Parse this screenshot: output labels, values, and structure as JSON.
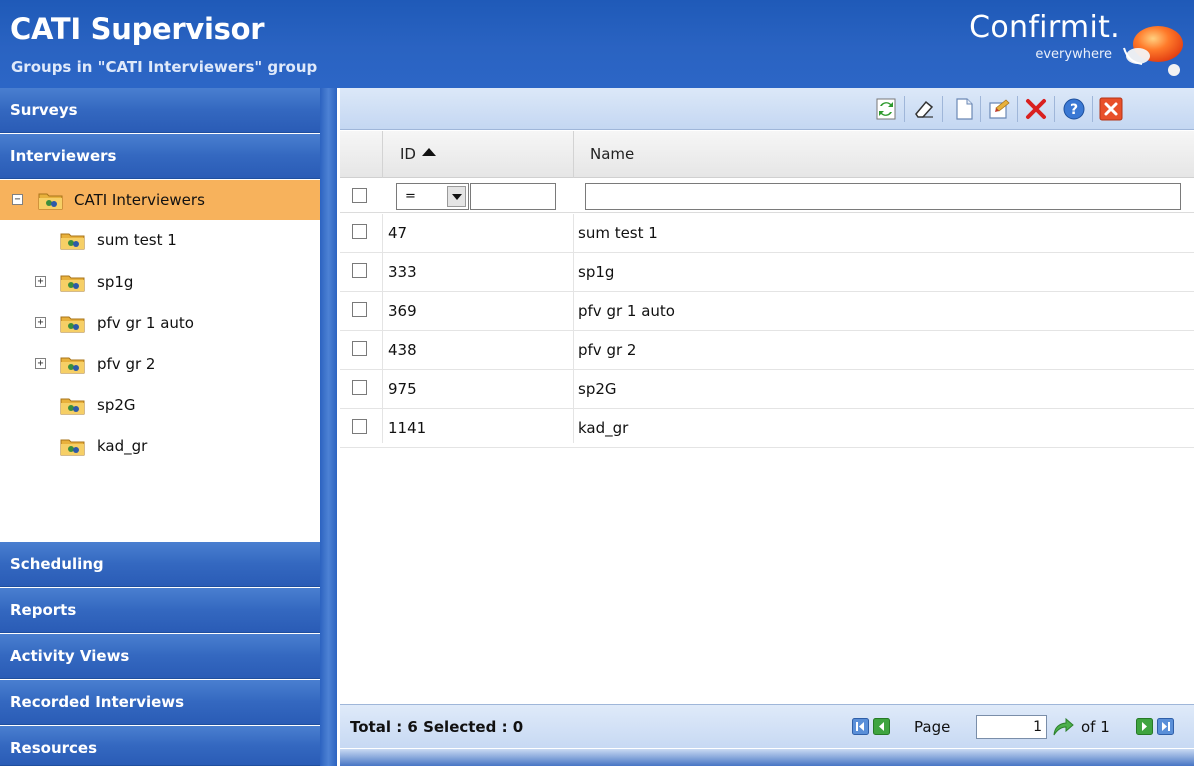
{
  "header": {
    "title": "CATI Supervisor",
    "subtitle": "Groups in \"CATI Interviewers\" group",
    "brand_name": "Confirmit.",
    "brand_tagline": "everywhere"
  },
  "sidebar": {
    "sections_top": [
      {
        "label": "Surveys"
      },
      {
        "label": "Interviewers"
      }
    ],
    "tree": [
      {
        "label": "CATI Interviewers",
        "expander": "minus",
        "selected": true,
        "level": 0
      },
      {
        "label": "sum test 1",
        "expander": "none",
        "selected": false,
        "level": 1
      },
      {
        "label": "sp1g",
        "expander": "plus",
        "selected": false,
        "level": 1
      },
      {
        "label": "pfv gr 1 auto",
        "expander": "plus",
        "selected": false,
        "level": 1
      },
      {
        "label": "pfv gr 2",
        "expander": "plus",
        "selected": false,
        "level": 1
      },
      {
        "label": "sp2G",
        "expander": "none",
        "selected": false,
        "level": 1
      },
      {
        "label": "kad_gr",
        "expander": "none",
        "selected": false,
        "level": 1
      }
    ],
    "sections_bottom": [
      {
        "label": "Scheduling"
      },
      {
        "label": "Reports"
      },
      {
        "label": "Activity Views"
      },
      {
        "label": "Recorded Interviews"
      },
      {
        "label": "Resources"
      }
    ]
  },
  "toolbar": {
    "buttons": [
      "refresh-icon",
      "eraser-icon",
      "new-document-icon",
      "edit-folder-icon",
      "delete-icon",
      "help-icon",
      "close-icon"
    ]
  },
  "grid": {
    "columns": {
      "id": "ID",
      "name": "Name"
    },
    "filter": {
      "operator": "=",
      "id_value": "",
      "name_value": ""
    },
    "rows": [
      {
        "id": "47",
        "name": "sum test 1"
      },
      {
        "id": "333",
        "name": "sp1g"
      },
      {
        "id": "369",
        "name": "pfv gr 1 auto"
      },
      {
        "id": "438",
        "name": "pfv gr 2"
      },
      {
        "id": "975",
        "name": "sp2G"
      },
      {
        "id": "1141",
        "name": "kad_gr"
      }
    ]
  },
  "footer": {
    "total_text": "Total : 6 Selected : 0",
    "page_label": "Page",
    "page_value": "1",
    "of_text": "of 1"
  },
  "colors": {
    "header_blue": "#2a63c2",
    "selected_orange": "#f7b25c",
    "delete_red": "#d92020",
    "close_orange": "#e8502a"
  }
}
